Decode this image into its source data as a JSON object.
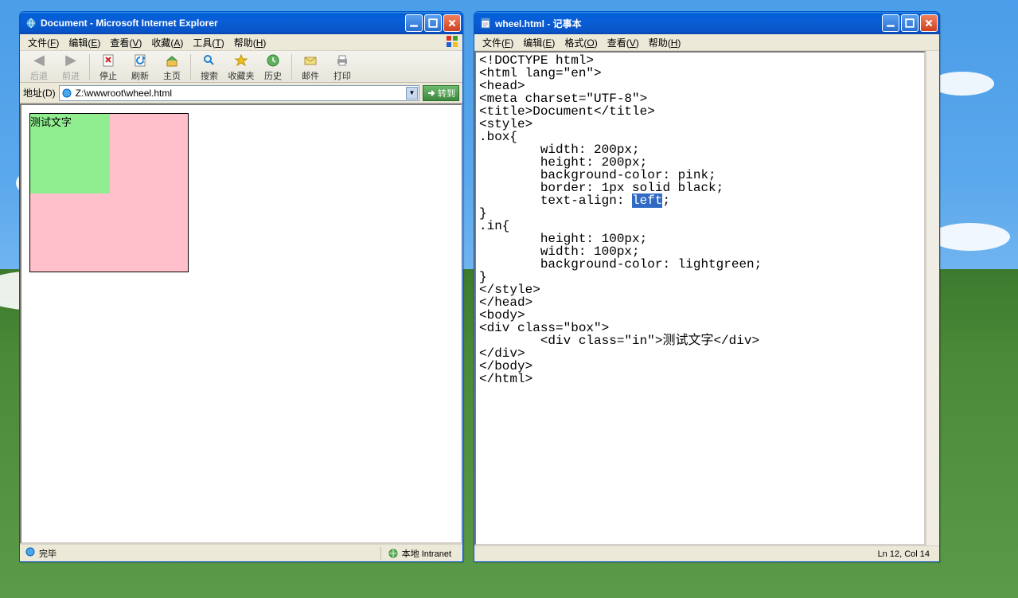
{
  "ie": {
    "title": "Document - Microsoft Internet Explorer",
    "menu": [
      "文件(F)",
      "编辑(E)",
      "查看(V)",
      "收藏(A)",
      "工具(T)",
      "帮助(H)"
    ],
    "toolbar": {
      "back": "后退",
      "forward": "前进",
      "stop": "停止",
      "refresh": "刷新",
      "home": "主页",
      "search": "搜索",
      "favorites": "收藏夹",
      "history": "历史",
      "mail": "邮件",
      "print": "打印"
    },
    "addr_label": "地址(D)",
    "addr_value": "Z:\\wwwroot\\wheel.html",
    "go_label": "转到",
    "page_text": "测试文字",
    "status_done": "完毕",
    "status_zone": "本地 Intranet"
  },
  "np": {
    "title": "wheel.html - 记事本",
    "menu": [
      "文件(F)",
      "编辑(E)",
      "格式(O)",
      "查看(V)",
      "帮助(H)"
    ],
    "code_pre": "<!DOCTYPE html>\n<html lang=\"en\">\n<head>\n<meta charset=\"UTF-8\">\n<title>Document</title>\n<style>\n.box{\n        width: 200px;\n        height: 200px;\n        background-color: pink;\n        border: 1px solid black;\n        text-align: ",
    "code_sel": "left",
    "code_post": ";\n}\n.in{\n        height: 100px;\n        width: 100px;\n        background-color: lightgreen;\n}\n</style>\n</head>\n<body>\n<div class=\"box\">\n        <div class=\"in\">测试文字</div>\n</div>\n</body>\n</html>",
    "status": "Ln 12, Col 14"
  }
}
